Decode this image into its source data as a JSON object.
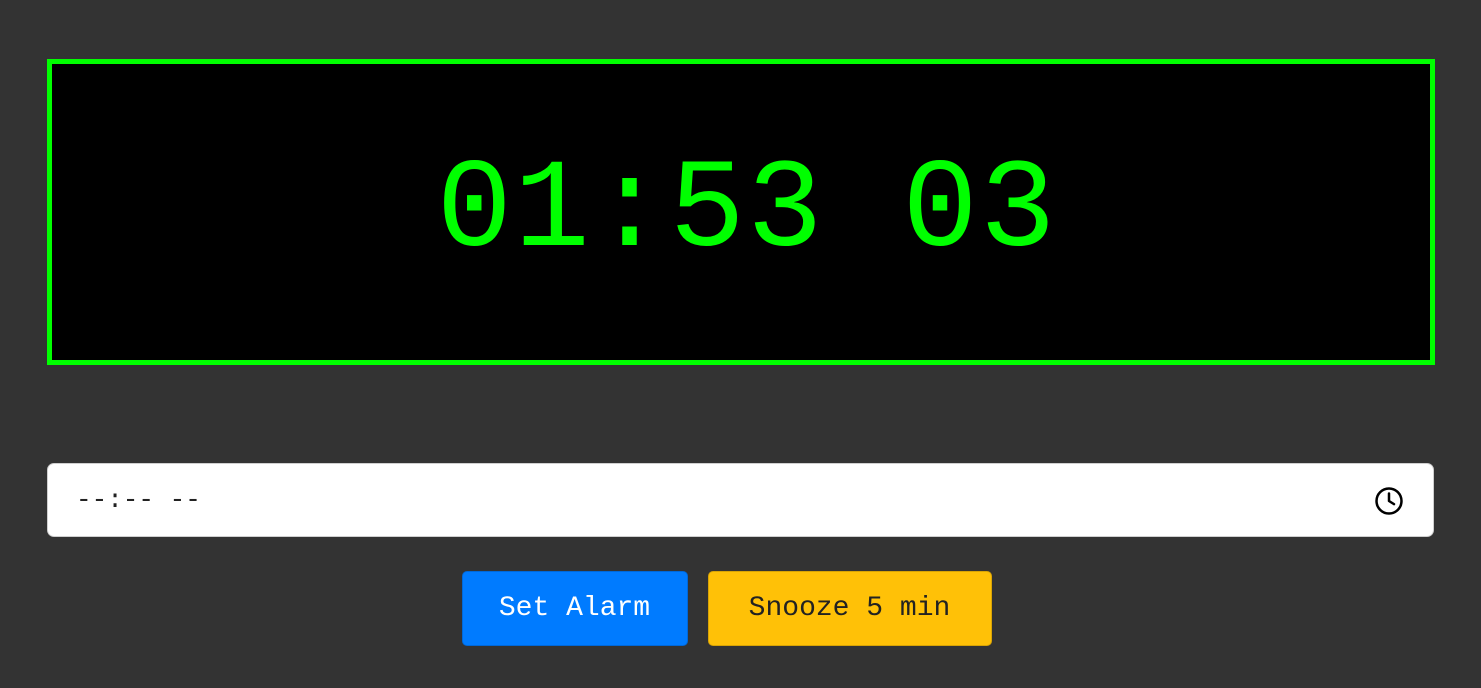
{
  "clock": {
    "time": "01:53 03"
  },
  "alarm_input": {
    "placeholder": "--:-- --",
    "icon": "clock-icon"
  },
  "buttons": {
    "set_alarm_label": "Set Alarm",
    "snooze_label": "Snooze 5 min"
  },
  "colors": {
    "background": "#333333",
    "display_background": "#000000",
    "display_accent": "#00ff00",
    "set_alarm": "#007bff",
    "snooze": "#ffc107"
  }
}
